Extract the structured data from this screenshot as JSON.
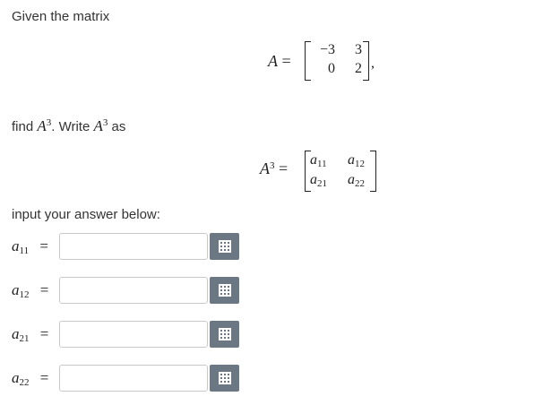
{
  "prompt": {
    "given": "Given the matrix",
    "find_prefix": "find",
    "write": ". Write",
    "as": "as",
    "input_instruction": "input your answer below:"
  },
  "matrix": {
    "name": "A",
    "equals": "=",
    "rows": [
      [
        "−3",
        "3"
      ],
      [
        "0",
        "2"
      ]
    ],
    "trailing": ","
  },
  "power": {
    "base": "A",
    "exp": "3",
    "entries": [
      [
        "a",
        "11"
      ],
      [
        "a",
        "12"
      ],
      [
        "a",
        "21"
      ],
      [
        "a",
        "22"
      ]
    ]
  },
  "answers": [
    {
      "var": "a",
      "sub": "11",
      "value": "",
      "placeholder": ""
    },
    {
      "var": "a",
      "sub": "12",
      "value": "",
      "placeholder": ""
    },
    {
      "var": "a",
      "sub": "21",
      "value": "",
      "placeholder": ""
    },
    {
      "var": "a",
      "sub": "22",
      "value": "",
      "placeholder": ""
    }
  ],
  "icons": {
    "keyboard": "keyboard-icon"
  },
  "colors": {
    "button_bg": "#6b7782",
    "input_border": "#c9c9c9"
  }
}
